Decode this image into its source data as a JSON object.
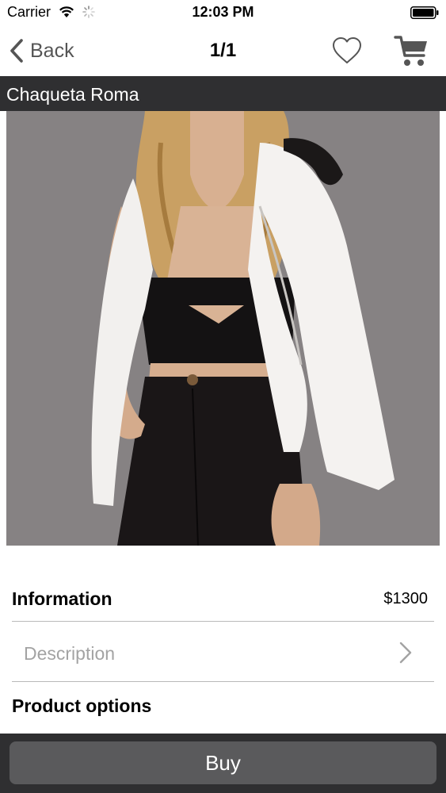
{
  "status_bar": {
    "carrier": "Carrier",
    "time": "12:03 PM"
  },
  "nav": {
    "back_label": "Back",
    "title": "1/1",
    "icons": [
      "chevron-left-icon",
      "heart-icon",
      "cart-icon"
    ]
  },
  "product": {
    "name": "Chaqueta Roma",
    "image": "product-photo"
  },
  "details": {
    "information_label": "Information",
    "price": "$1300",
    "description_label": "Description",
    "product_options_label": "Product options"
  },
  "footer": {
    "buy_label": "Buy"
  },
  "colors": {
    "header_bar": "#2f2f31",
    "buy_button": "#5a5a5c",
    "divider": "#b9b9b9",
    "placeholder_text": "#a3a3a3"
  }
}
